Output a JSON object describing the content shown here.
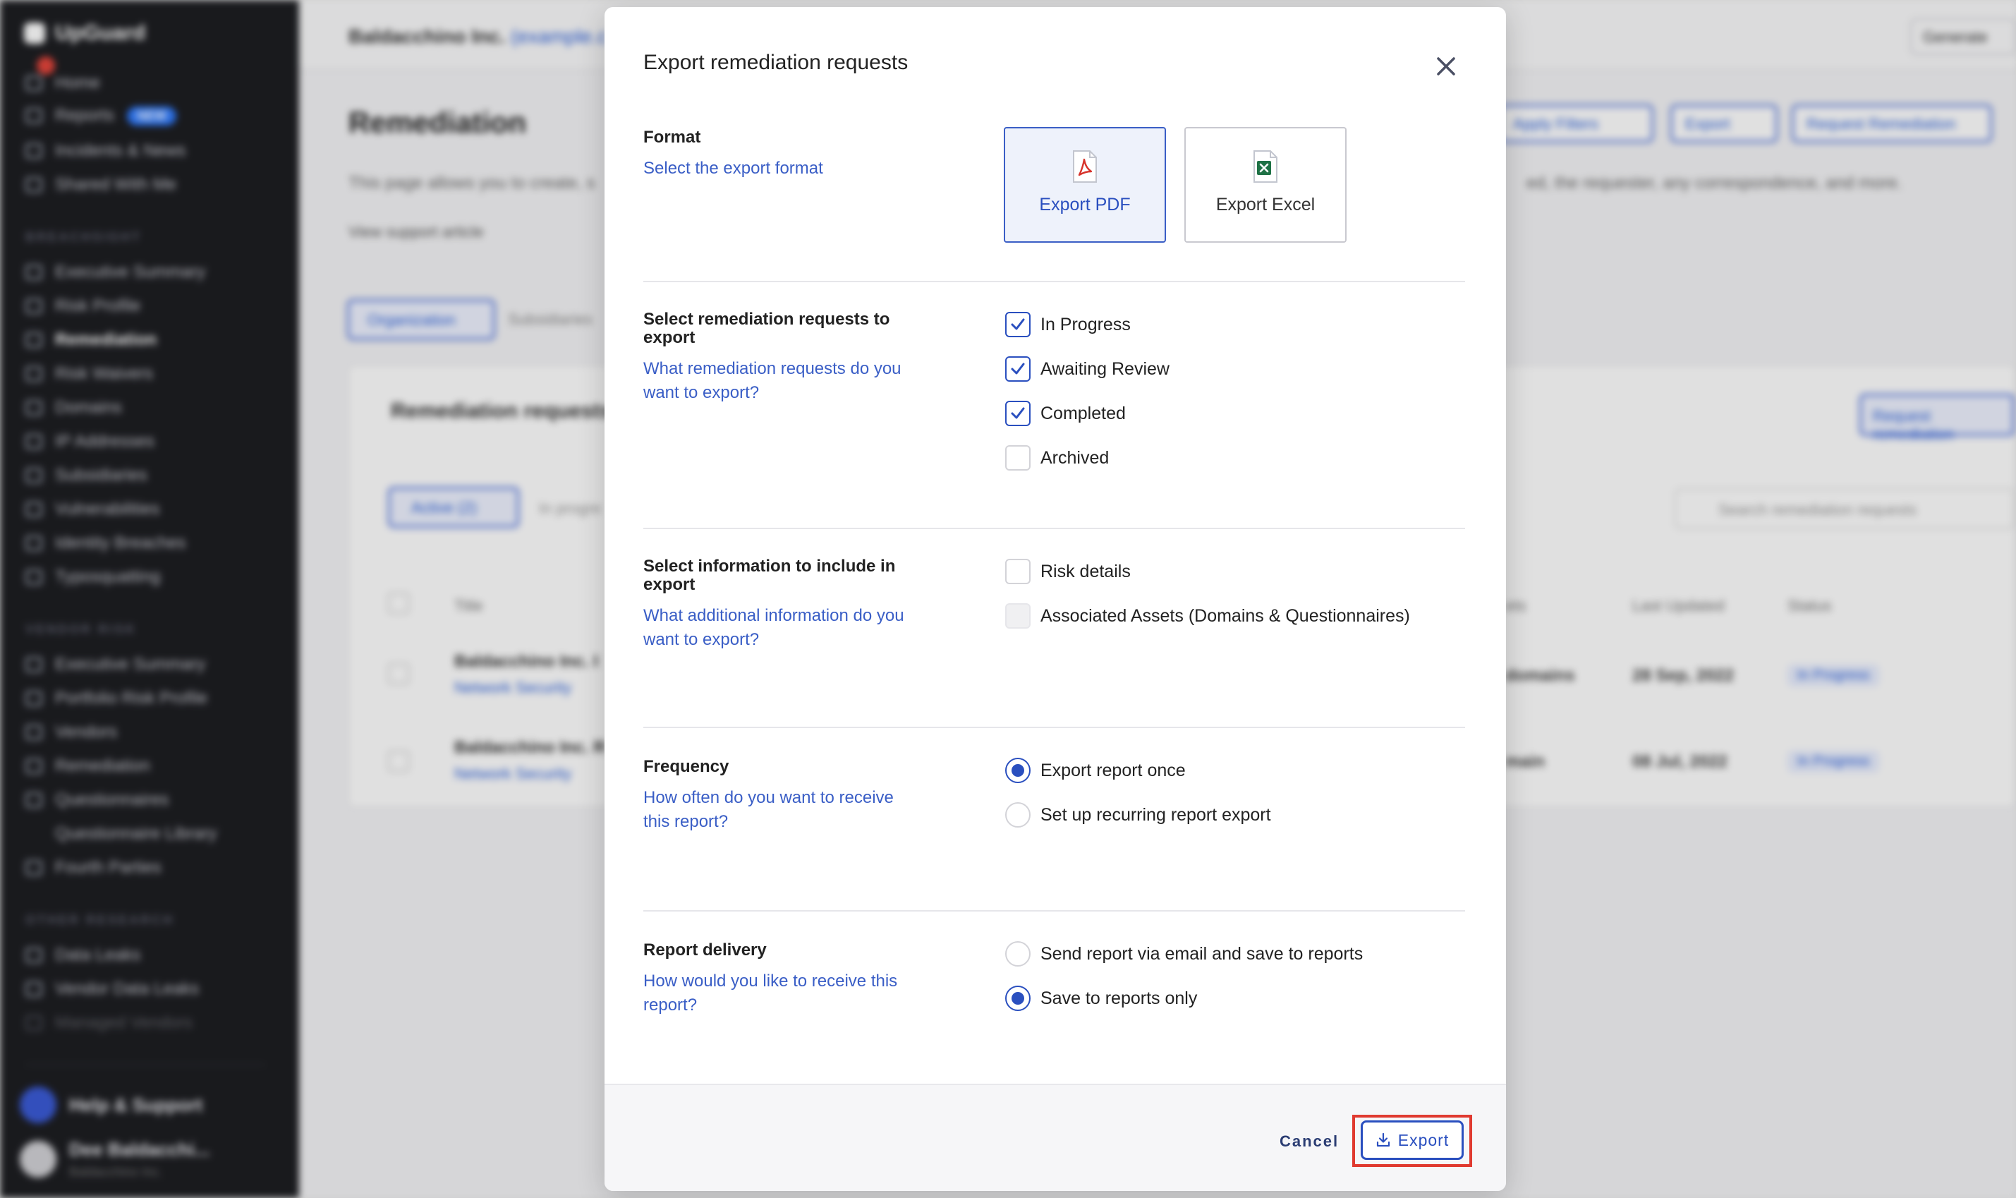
{
  "background": {
    "sidebar": {
      "logo": "UpGuard",
      "top_items": [
        {
          "label": "Home",
          "icon": "home-icon"
        },
        {
          "label": "Reports",
          "icon": "reports-icon",
          "badge": "NEW"
        },
        {
          "label": "Incidents & News",
          "icon": "news-icon"
        },
        {
          "label": "Shared With Me",
          "icon": "shared-icon"
        }
      ],
      "section_breach": "BREACHSIGHT",
      "breach_items": [
        {
          "label": "Executive Summary",
          "icon": "summary-icon"
        },
        {
          "label": "Risk Profile",
          "icon": "risk-icon"
        },
        {
          "label": "Remediation",
          "icon": "wrench-icon",
          "active": true
        },
        {
          "label": "Risk Waivers",
          "icon": "waiver-icon"
        },
        {
          "label": "Domains",
          "icon": "globe-icon"
        },
        {
          "label": "IP Addresses",
          "icon": "ip-icon"
        },
        {
          "label": "Subsidiaries",
          "icon": "subsidiaries-icon"
        },
        {
          "label": "Vulnerabilities",
          "icon": "bug-icon"
        },
        {
          "label": "Identity Breaches",
          "icon": "identity-icon"
        },
        {
          "label": "Typosquatting",
          "icon": "typo-icon"
        }
      ],
      "section_vendor": "VENDOR RISK",
      "vendor_items": [
        {
          "label": "Executive Summary",
          "icon": "summary-icon"
        },
        {
          "label": "Portfolio Risk Profile",
          "icon": "portfolio-icon"
        },
        {
          "label": "Vendors",
          "icon": "vendors-icon"
        },
        {
          "label": "Remediation",
          "icon": "wrench-icon"
        },
        {
          "label": "Questionnaires",
          "icon": "questionnaire-icon"
        },
        {
          "label": "Questionnaire Library",
          "icon": "library-icon"
        },
        {
          "label": "Fourth Parties",
          "icon": "fourth-icon"
        }
      ],
      "section_other": "OTHER RESEARCH",
      "other_items": [
        {
          "label": "Data Leaks",
          "icon": "leak-icon"
        },
        {
          "label": "Vendor Data Leaks",
          "icon": "leak-icon"
        },
        {
          "label": "Managed Vendors",
          "icon": "managed-icon"
        }
      ],
      "help": "Help & Support",
      "user_name": "Dee Baldacchi...",
      "user_org": "Baldacchino Inc."
    },
    "main": {
      "org": "Baldacchino Inc.",
      "org_link": "(example.c",
      "generate": "Generate",
      "title": "Remediation",
      "desc": "This page allows you to create, s",
      "desc_right": "ed, the requester, any correspondence, and more.",
      "support": "View support article",
      "btn_filters": "Apply Filters",
      "btn_export": "Export",
      "btn_request": "Request Remediation",
      "tab_org": "Organization",
      "tab_sub": "Subsidiaries",
      "card_title": "Remediation requests",
      "card_btn": "Request remediation",
      "pill_active": "Active (2)",
      "pill_progress": "In progre",
      "search_placeholder": "Search remediation requests",
      "col_title": "Title",
      "col_assets": "ets",
      "col_updated": "Last Updated",
      "col_status": "Status",
      "rows": [
        {
          "title": "Baldacchino Inc. I",
          "sub": "Network Security",
          "assets": "domains",
          "date": "28 Sep, 2022",
          "status": "In Progress"
        },
        {
          "title": "Baldacchino Inc. R",
          "sub": "Network Security",
          "assets": "main",
          "date": "08 Jul, 2022",
          "status": "In Progress"
        }
      ]
    }
  },
  "modal": {
    "title": "Export remediation requests",
    "format": {
      "label": "Format",
      "help": "Select the export format",
      "options": [
        {
          "label": "Export PDF",
          "icon": "pdf-file-icon",
          "selected": true
        },
        {
          "label": "Export Excel",
          "icon": "excel-file-icon",
          "selected": false
        }
      ]
    },
    "requests": {
      "label": "Select remediation requests to export",
      "help": "What remediation requests do you want to export?",
      "options": [
        {
          "label": "In Progress",
          "checked": true
        },
        {
          "label": "Awaiting Review",
          "checked": true
        },
        {
          "label": "Completed",
          "checked": true
        },
        {
          "label": "Archived",
          "checked": false
        }
      ]
    },
    "info": {
      "label": "Select information to include in export",
      "help": "What additional information do you want to export?",
      "options": [
        {
          "label": "Risk details",
          "checked": false
        },
        {
          "label": "Associated Assets (Domains & Questionnaires)",
          "checked": false,
          "disabled": true
        }
      ]
    },
    "frequency": {
      "label": "Frequency",
      "help": "How often do you want to receive this report?",
      "options": [
        {
          "label": "Export report once",
          "selected": true
        },
        {
          "label": "Set up recurring report export",
          "selected": false
        }
      ]
    },
    "delivery": {
      "label": "Report delivery",
      "help": "How would you like to receive this report?",
      "options": [
        {
          "label": "Send report via email and save to reports",
          "selected": false
        },
        {
          "label": "Save to reports only",
          "selected": true
        }
      ]
    },
    "footer": {
      "cancel": "Cancel",
      "export": "Export"
    }
  },
  "colors": {
    "accent": "#2a4fbf",
    "highlight": "#e03a30",
    "sidebar_bg": "#1d1e22"
  }
}
